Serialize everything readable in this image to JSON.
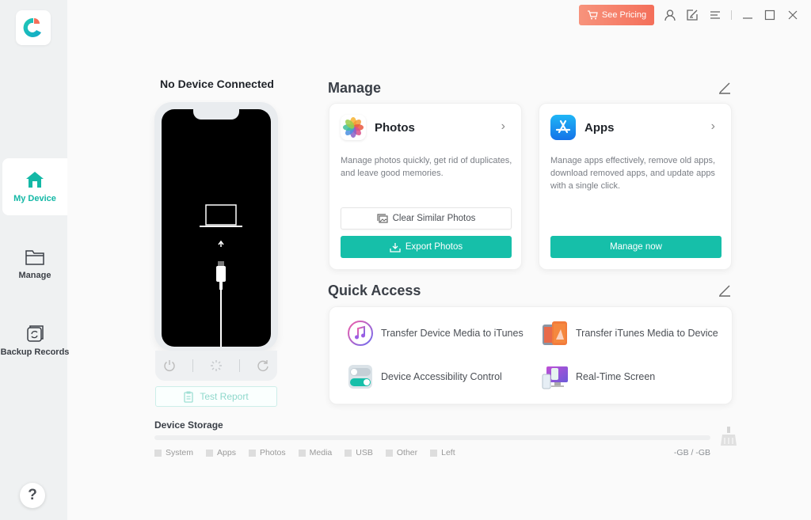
{
  "app": {
    "colors": {
      "accent": "#16bfa9",
      "pricing": "#f47c66",
      "sidebar_bg": "#eff1f2"
    }
  },
  "topbar": {
    "pricing_label": "See Pricing",
    "icons": [
      "cart-icon",
      "user-icon",
      "feedback-icon",
      "menu-icon",
      "minimize-icon",
      "maximize-icon",
      "close-icon"
    ]
  },
  "sidebar": {
    "items": [
      {
        "label": "My Device",
        "icon": "home-icon",
        "active": true
      },
      {
        "label": "Manage",
        "icon": "folder-icon",
        "active": false
      },
      {
        "label": "Backup Records",
        "icon": "backup-icon",
        "active": false
      }
    ],
    "help_label": "?"
  },
  "device": {
    "title": "No Device Connected",
    "test_report_label": "Test Report"
  },
  "manage": {
    "title": "Manage",
    "cards": [
      {
        "title": "Photos",
        "description": "Manage photos quickly, get rid of duplicates, and leave good memories.",
        "secondary_button": "Clear Similar Photos",
        "primary_button": "Export Photos"
      },
      {
        "title": "Apps",
        "description": "Manage apps effectively, remove old apps, download removed apps, and update apps with a single click.",
        "primary_button": "Manage now"
      }
    ]
  },
  "quick_access": {
    "title": "Quick Access",
    "items": [
      {
        "label": "Transfer Device Media to iTunes"
      },
      {
        "label": "Transfer iTunes Media to Device"
      },
      {
        "label": "Device Accessibility Control"
      },
      {
        "label": "Real-Time Screen"
      }
    ]
  },
  "storage": {
    "title": "Device Storage",
    "legend": [
      "System",
      "Apps",
      "Photos",
      "Media",
      "USB",
      "Other",
      "Left"
    ],
    "value": "-GB / -GB"
  }
}
